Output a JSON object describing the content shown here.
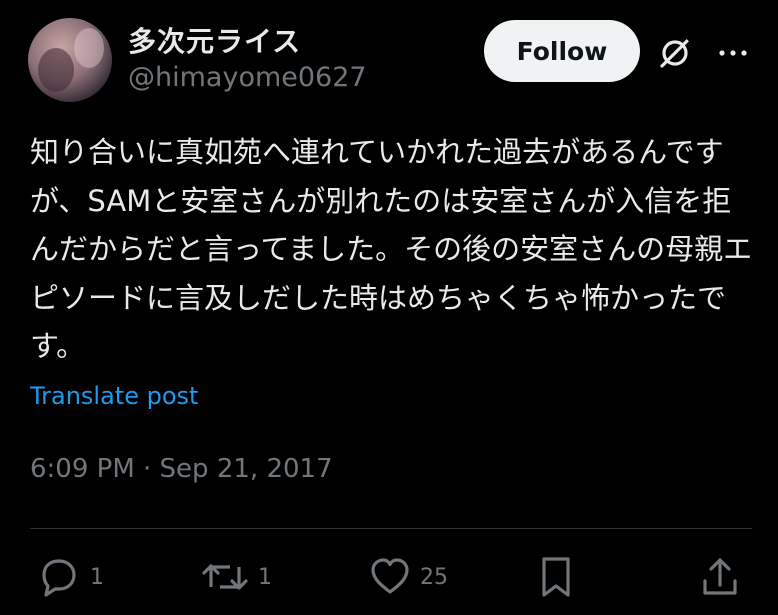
{
  "author": {
    "display_name": "多次元ライス",
    "handle": "@himayome0627"
  },
  "header": {
    "follow_label": "Follow",
    "grok_icon": "grok-slash-icon",
    "more_icon": "more-horizontal-icon"
  },
  "post": {
    "text": "知り合いに真如苑へ連れていかれた過去があるんですが、SAMと安室さんが別れたのは安室さんが入信を拒んだからだと言ってました。その後の安室さんの母親エピソードに言及しだした時はめちゃくちゃ怖かったです。",
    "translate_label": "Translate post",
    "timestamp": "6:09 PM · Sep 21, 2017"
  },
  "actions": {
    "reply_count": "1",
    "repost_count": "1",
    "like_count": "25",
    "reply_icon": "reply-bubble-icon",
    "repost_icon": "repost-icon",
    "like_icon": "heart-icon",
    "bookmark_icon": "bookmark-icon",
    "share_icon": "share-icon"
  },
  "colors": {
    "background": "#000000",
    "text_primary": "#e7e9ea",
    "text_secondary": "#71767b",
    "link": "#1d9bf0",
    "follow_bg": "#eff3f4",
    "divider": "#2f3336"
  }
}
